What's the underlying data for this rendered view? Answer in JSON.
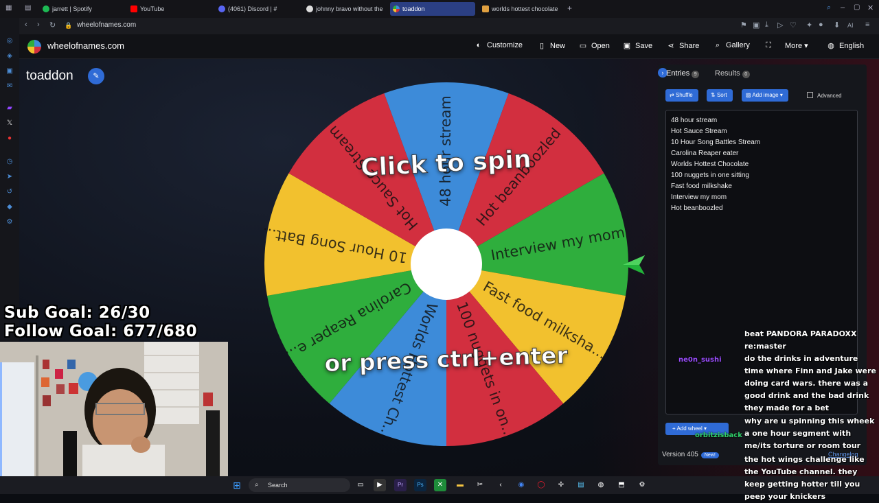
{
  "browser": {
    "tabs": [
      {
        "label": "jarrett | Spotify",
        "color": "#1db954"
      },
      {
        "label": "YouTube",
        "color": "#ff0000"
      },
      {
        "label": "(4061) Discord | #",
        "color": "#5865f2"
      },
      {
        "label": "johnny bravo without the",
        "color": "#dddddd"
      },
      {
        "label": "toaddon",
        "color": "#3d8bd9"
      },
      {
        "label": "worlds hottest chocolate",
        "color": "#e0a040"
      }
    ],
    "new_tab": "+",
    "url": "wheelofnames.com"
  },
  "site": {
    "name": "wheelofnames.com",
    "nav": {
      "customize": "Customize",
      "new": "New",
      "open": "Open",
      "save": "Save",
      "share": "Share",
      "gallery": "Gallery",
      "more": "More",
      "language": "English"
    }
  },
  "wheel": {
    "title": "toaddon",
    "center_text_top": "Click to spin",
    "center_text_bottom": "or press ctrl+enter",
    "segments": [
      {
        "label": "48 hour stream",
        "color": "#3d8bd9"
      },
      {
        "label": "Hot beanboozled",
        "color": "#d22f3f"
      },
      {
        "label": "Interview my mom",
        "color": "#2fae3d"
      },
      {
        "label": "Fast food milksha...",
        "color": "#f2c12e"
      },
      {
        "label": "100 nuggets in on...",
        "color": "#d22f3f"
      },
      {
        "label": "Worlds Hottest Ch...",
        "color": "#3d8bd9"
      },
      {
        "label": "Carolina Reaper e...",
        "color": "#2fae3d"
      },
      {
        "label": "10 Hour Song Batt...",
        "color": "#f2c12e"
      },
      {
        "label": "Hot Sauce Stream",
        "color": "#d22f3f"
      }
    ]
  },
  "panel": {
    "tab_entries": "Entries",
    "entries_count": "9",
    "tab_results": "Results",
    "results_count": "0",
    "shuffle": "Shuffle",
    "sort": "Sort",
    "add_image": "Add image",
    "advanced": "Advanced",
    "entries": [
      "48 hour stream",
      "Hot Sauce Stream",
      "10 Hour Song Battles Stream",
      "Carolina Reaper eater",
      "Worlds Hottest Chocolate",
      "100 nuggets in one sitting",
      "Fast food milkshake",
      "Interview my mom",
      "Hot beanboozled"
    ],
    "add_wheel": "Add wheel",
    "version": "Version 405",
    "new_badge": "New!",
    "changelog": "Changelog"
  },
  "overlay": {
    "sub_goal": "Sub Goal: 26/30",
    "follow_goal": "Follow Goal: 677/680"
  },
  "chat": {
    "msg1": "beat PANDORA PARADOXX re:master",
    "user2": "ne0n_sushi",
    "msg2": "do the drinks in adventure time where Finn and Jake were doing card wars. there was a good drink and the bad drink they made for a bet",
    "user3": "orbitzisback",
    "msg3": "why are u spinning this wheek a one hour segment with me/its torture or room tour",
    "msg4": "the hot wings challenge like the YouTube channel. they keep getting hotter till you peep your knickers"
  },
  "taskbar": {
    "search": "Search"
  }
}
